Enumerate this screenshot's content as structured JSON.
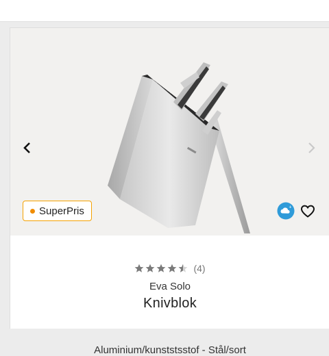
{
  "badge": {
    "label": "SuperPris",
    "color": "#f5a100"
  },
  "icons": {
    "prev": "chevron-left-icon",
    "next": "chevron-right-icon",
    "climate": "cloud-plus-icon",
    "favorite": "heart-outline-icon"
  },
  "rating": {
    "stars": 4.5,
    "max": 5,
    "count_text": "(4)"
  },
  "product": {
    "brand": "Eva Solo",
    "name": "Knivblok",
    "material": "Aluminium/kunststsstof - Stål/sort"
  }
}
